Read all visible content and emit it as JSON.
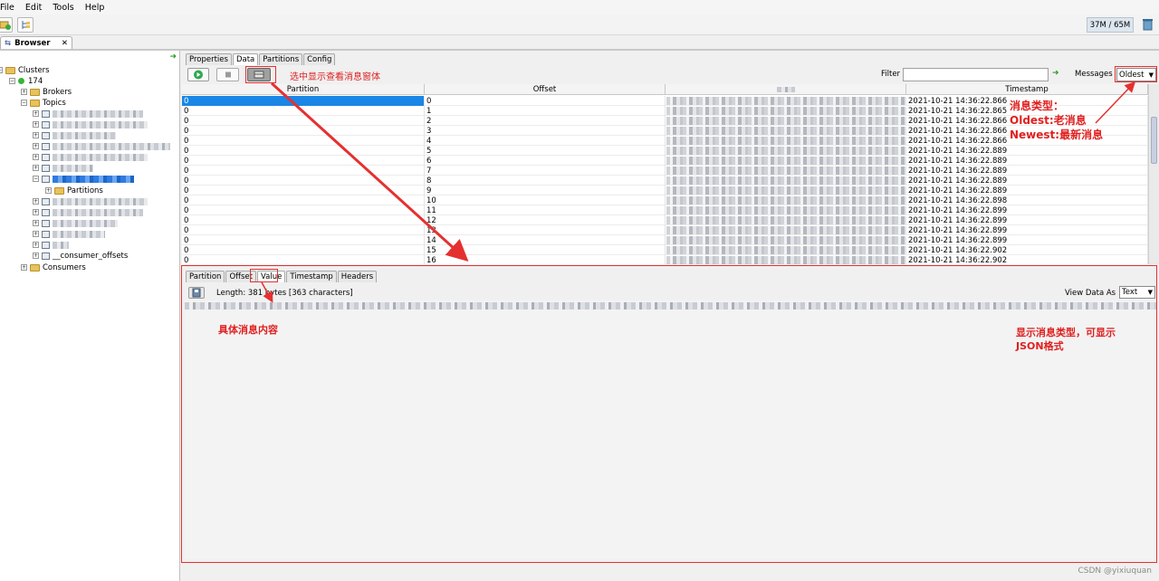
{
  "menu": [
    "File",
    "Edit",
    "Tools",
    "Help"
  ],
  "toolbar": {
    "memory": "37M / 65M"
  },
  "editor_tab": {
    "label": "Browser",
    "close": "✕"
  },
  "tree": {
    "root": "Clusters",
    "cluster": "174",
    "brokers": "Brokers",
    "topics": "Topics",
    "partitions": "Partitions",
    "consumer_offsets": "__consumer_offsets",
    "consumers": "Consumers"
  },
  "top_tabs": [
    "Properties",
    "Data",
    "Partitions",
    "Config"
  ],
  "data_toolbar": {
    "filter_label": "Filter",
    "filter_value": "",
    "messages_label": "Messages",
    "messages_value": "Oldest"
  },
  "grid": {
    "columns": [
      "Partition",
      "Offset",
      "Value",
      "Timestamp"
    ],
    "rows": [
      {
        "partition": "0",
        "offset": "0",
        "timestamp": "2021-10-21 14:36:22.866"
      },
      {
        "partition": "0",
        "offset": "1",
        "timestamp": "2021-10-21 14:36:22.865"
      },
      {
        "partition": "0",
        "offset": "2",
        "timestamp": "2021-10-21 14:36:22.866"
      },
      {
        "partition": "0",
        "offset": "3",
        "timestamp": "2021-10-21 14:36:22.866"
      },
      {
        "partition": "0",
        "offset": "4",
        "timestamp": "2021-10-21 14:36:22.866"
      },
      {
        "partition": "0",
        "offset": "5",
        "timestamp": "2021-10-21 14:36:22.889"
      },
      {
        "partition": "0",
        "offset": "6",
        "timestamp": "2021-10-21 14:36:22.889"
      },
      {
        "partition": "0",
        "offset": "7",
        "timestamp": "2021-10-21 14:36:22.889"
      },
      {
        "partition": "0",
        "offset": "8",
        "timestamp": "2021-10-21 14:36:22.889"
      },
      {
        "partition": "0",
        "offset": "9",
        "timestamp": "2021-10-21 14:36:22.889"
      },
      {
        "partition": "0",
        "offset": "10",
        "timestamp": "2021-10-21 14:36:22.898"
      },
      {
        "partition": "0",
        "offset": "11",
        "timestamp": "2021-10-21 14:36:22.899"
      },
      {
        "partition": "0",
        "offset": "12",
        "timestamp": "2021-10-21 14:36:22.899"
      },
      {
        "partition": "0",
        "offset": "13",
        "timestamp": "2021-10-21 14:36:22.899"
      },
      {
        "partition": "0",
        "offset": "14",
        "timestamp": "2021-10-21 14:36:22.899"
      },
      {
        "partition": "0",
        "offset": "15",
        "timestamp": "2021-10-21 14:36:22.902"
      },
      {
        "partition": "0",
        "offset": "16",
        "timestamp": "2021-10-21 14:36:22.902"
      }
    ]
  },
  "bottom_tabs": [
    "Partition",
    "Offset",
    "Value",
    "Timestamp",
    "Headers"
  ],
  "detail": {
    "length_text": "Length: 381 bytes [363 characters]",
    "view_as_label": "View Data As",
    "view_as_value": "Text"
  },
  "annotations": {
    "view_button": "选中显示查看消息窗体",
    "msg_type_title": "消息类型：",
    "oldest": "Oldest:老消息",
    "newest": "Newest:最新消息",
    "content": "具体消息内容",
    "format_line1": "显示消息类型，可显示",
    "format_line2": "JSON格式"
  },
  "colors": {
    "annotation": "#e53030",
    "selection": "#1a86e6"
  },
  "watermark": "CSDN @yixiuquan"
}
